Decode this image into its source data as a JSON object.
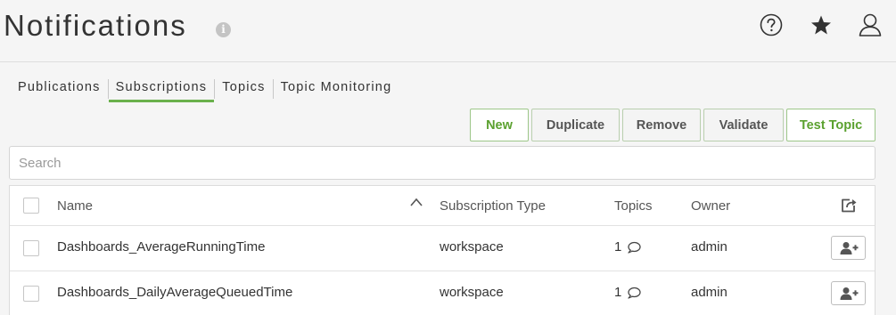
{
  "header": {
    "title": "Notifications",
    "info_icon": "info-icon",
    "icons": [
      "help-icon",
      "star-icon",
      "user-icon"
    ]
  },
  "tabs": [
    {
      "label": "Publications",
      "active": false
    },
    {
      "label": "Subscriptions",
      "active": true
    },
    {
      "label": "Topics",
      "active": false
    },
    {
      "label": "Topic Monitoring",
      "active": false
    }
  ],
  "toolbar": {
    "new_label": "New",
    "duplicate_label": "Duplicate",
    "remove_label": "Remove",
    "validate_label": "Validate",
    "test_topic_label": "Test Topic"
  },
  "search": {
    "placeholder": "Search",
    "value": ""
  },
  "table": {
    "columns": [
      "Name",
      "Subscription Type",
      "Topics",
      "Owner"
    ],
    "sort": {
      "column": "Name",
      "direction": "ascending"
    },
    "rows": [
      {
        "name": "Dashboards_AverageRunningTime",
        "type": "workspace",
        "topics": "1",
        "owner": "admin"
      },
      {
        "name": "Dashboards_DailyAverageQueuedTime",
        "type": "workspace",
        "topics": "1",
        "owner": "admin"
      }
    ]
  },
  "colors": {
    "accent": "#6ab04c",
    "button_text": "#5ba12f",
    "background": "#f5f5f5"
  }
}
